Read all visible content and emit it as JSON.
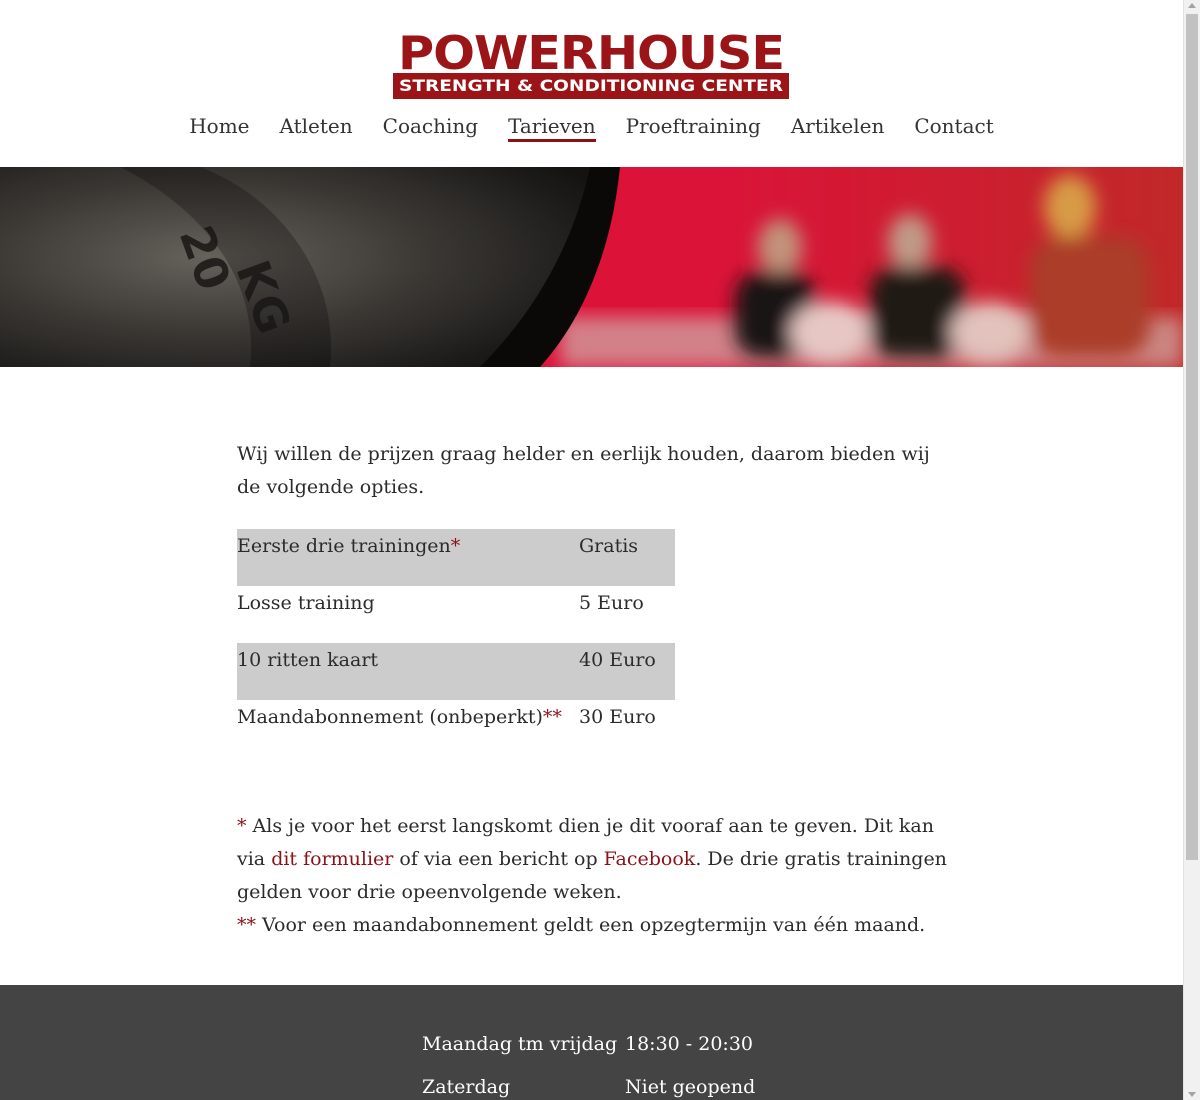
{
  "header": {
    "logo": {
      "wordmark": "POWERHOUSE",
      "tagline": "STRENGTH & CONDITIONING CENTER",
      "colors": {
        "red": "#9b1518",
        "white": "#ffffff"
      }
    },
    "nav": [
      {
        "label": "Home",
        "active": false
      },
      {
        "label": "Atleten",
        "active": false
      },
      {
        "label": "Coaching",
        "active": false
      },
      {
        "label": "Tarieven",
        "active": true
      },
      {
        "label": "Proeftraining",
        "active": false
      },
      {
        "label": "Artikelen",
        "active": false
      },
      {
        "label": "Contact",
        "active": false
      }
    ],
    "accent_color": "#8b1118"
  },
  "main": {
    "intro": "Wij willen de prijzen graag helder en eerlijk houden, daarom bieden wij de volgende opties.",
    "prices": [
      {
        "name": "Eerste drie trainingen",
        "mark": "*",
        "price": "Gratis",
        "shaded": true
      },
      {
        "name": "Losse training",
        "mark": "",
        "price": "5 Euro",
        "shaded": false
      },
      {
        "name": "10 ritten kaart",
        "mark": "",
        "price": "40 Euro",
        "shaded": true
      },
      {
        "name": "Maandabonnement (onbeperkt)",
        "mark": "**",
        "price": "30 Euro",
        "shaded": false
      }
    ],
    "footnote1": {
      "mark": "*",
      "text_a": " Als je voor het eerst langskomt dien je dit vooraf aan te geven. Dit kan via ",
      "link1": "dit formulier",
      "text_b": " of via een bericht op ",
      "link2": "Facebook",
      "text_c": ". De drie gratis trainingen gelden voor drie opeenvolgende weken."
    },
    "footnote2": {
      "mark": "**",
      "text": " Voor een maandabonnement geldt een opzegtermijn van één maand."
    }
  },
  "footer": {
    "hours": [
      {
        "day": "Maandag tm vrijdag",
        "time": "18:30 - 20:30"
      },
      {
        "day": "Zaterdag",
        "time": "Niet geopend"
      }
    ]
  }
}
